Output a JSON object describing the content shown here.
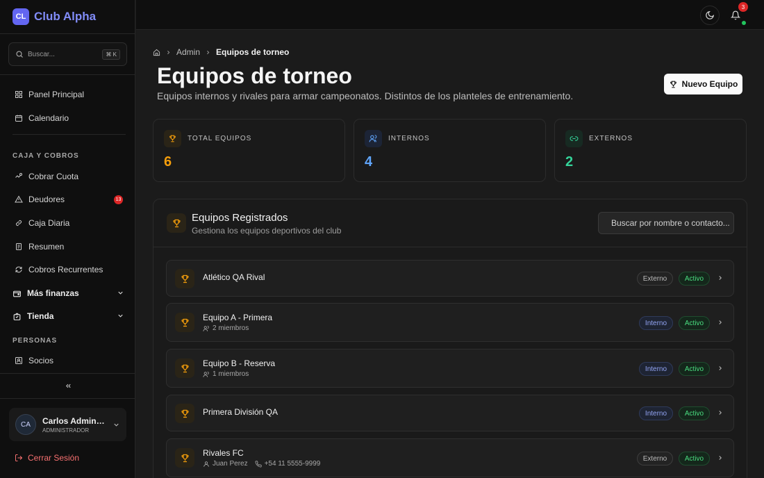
{
  "brand": {
    "logo": "CL",
    "name": "Club Alpha"
  },
  "sidebar": {
    "search": {
      "placeholder": "Buscar...",
      "shortcut": "⌘ K"
    },
    "items_top": [
      {
        "label": "Panel Principal",
        "icon": "layout-grid-icon"
      },
      {
        "label": "Calendario",
        "icon": "calendar-icon"
      }
    ],
    "section_finance": "CAJA Y COBROS",
    "items_finance": [
      {
        "label": "Cobrar Cuota",
        "icon": "hand-coins-icon"
      },
      {
        "label": "Deudores",
        "icon": "alert-triangle-icon",
        "badge": "13"
      },
      {
        "label": "Caja Diaria",
        "icon": "wallet-icon"
      },
      {
        "label": "Resumen",
        "icon": "receipt-icon"
      },
      {
        "label": "Cobros Recurrentes",
        "icon": "repeat-icon"
      }
    ],
    "groups": [
      {
        "label": "Más finanzas",
        "icon": "wallet-icon"
      },
      {
        "label": "Tienda",
        "icon": "shopping-bag-icon"
      }
    ],
    "section_people": "PERSONAS",
    "items_people": [
      {
        "label": "Socios",
        "icon": "id-card-icon"
      }
    ],
    "user": {
      "initials": "CA",
      "name": "Carlos Administrador",
      "role": "ADMINISTRADOR"
    },
    "logout": "Cerrar Sesión"
  },
  "topbar": {
    "notifications": "3"
  },
  "breadcrumb": {
    "parent": "Admin",
    "current": "Equipos de torneo"
  },
  "page": {
    "title": "Equipos de torneo",
    "subtitle": "Equipos internos y rivales para armar campeonatos. Distintos de los planteles de entrenamiento.",
    "new_button": "Nuevo Equipo"
  },
  "stats": [
    {
      "label": "TOTAL EQUIPOS",
      "value": "6",
      "color": "#f59e0b",
      "icon": "trophy-icon"
    },
    {
      "label": "INTERNOS",
      "value": "4",
      "color": "#60a5fa",
      "icon": "users-icon"
    },
    {
      "label": "EXTERNOS",
      "value": "2",
      "color": "#34d399",
      "icon": "link-icon"
    }
  ],
  "panel": {
    "title": "Equipos Registrados",
    "subtitle": "Gestiona los equipos deportivos del club",
    "search_placeholder": "Buscar por nombre o contacto...",
    "teams": [
      {
        "name": "Atlético QA Rival",
        "type": "Externo",
        "status": "Activo"
      },
      {
        "name": "Equipo A - Primera",
        "members": "2 miembros",
        "type": "Interno",
        "status": "Activo"
      },
      {
        "name": "Equipo B - Reserva",
        "members": "1 miembros",
        "type": "Interno",
        "status": "Activo"
      },
      {
        "name": "Primera División QA",
        "type": "Interno",
        "status": "Activo"
      },
      {
        "name": "Rivales FC",
        "contact": "Juan Perez",
        "phone": "+54 11 5555-9999",
        "type": "Externo",
        "status": "Activo"
      }
    ]
  }
}
